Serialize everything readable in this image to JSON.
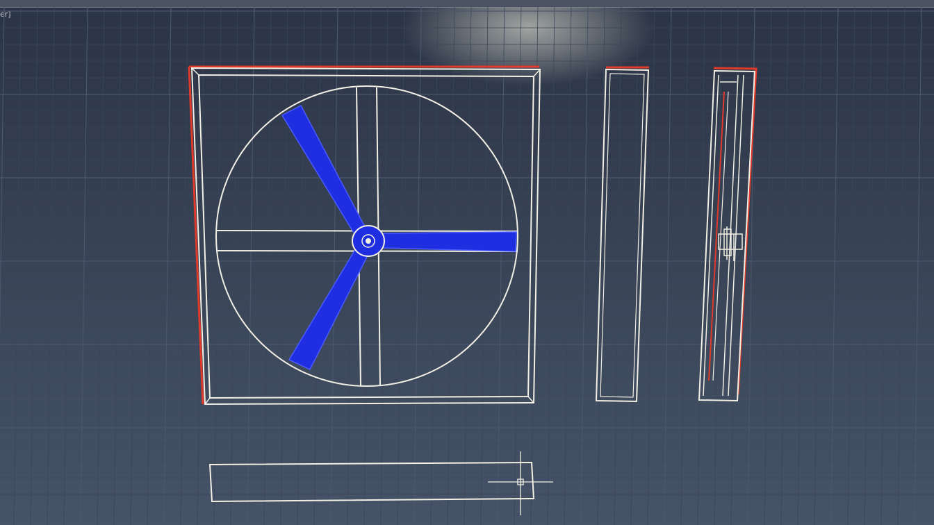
{
  "app": {
    "viewport_label": "er]"
  },
  "colors": {
    "background": "#2f3a4d",
    "grid_minor": "#3b4659",
    "grid_major": "#4a566b",
    "linework": "#f2f0e4",
    "selection": "#e03a2a",
    "blade_fill": "#1f2ee0",
    "blade_stroke": "#4a5cff"
  },
  "icons": {
    "cursor": "crosshair-cursor-icon",
    "hub": "fan-hub-icon"
  }
}
